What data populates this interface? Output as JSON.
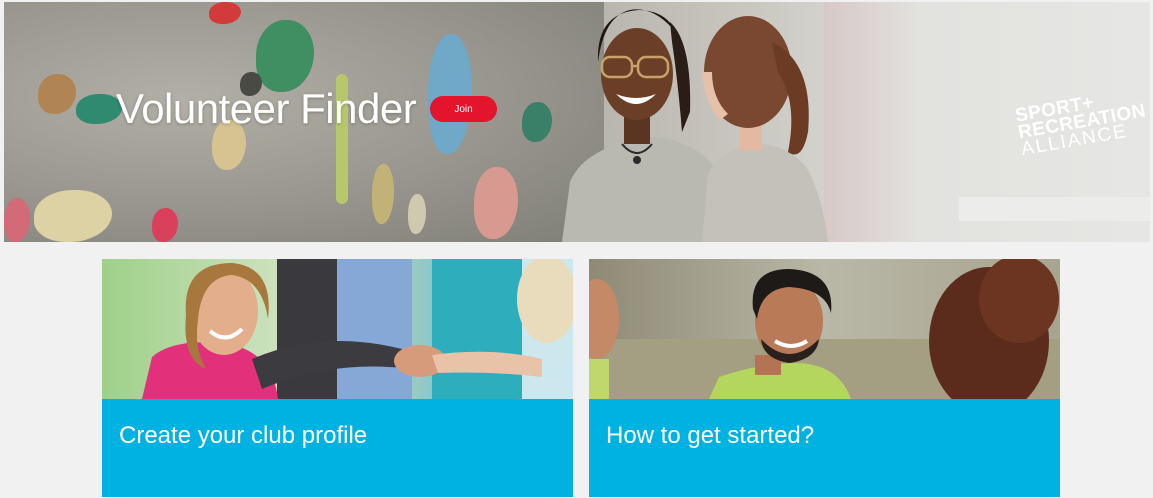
{
  "hero": {
    "title": "Volunteer Finder",
    "join_label": "Join",
    "logo": {
      "line1": "SPORT+",
      "line2": "RECREATION",
      "line3": "ALLIANCE"
    }
  },
  "cards": [
    {
      "title": "Create your club profile"
    },
    {
      "title": "How to get started?"
    }
  ],
  "colors": {
    "accent_blue": "#00b2e1",
    "join_red": "#e3142b",
    "page_bg": "#f1f1f1"
  }
}
